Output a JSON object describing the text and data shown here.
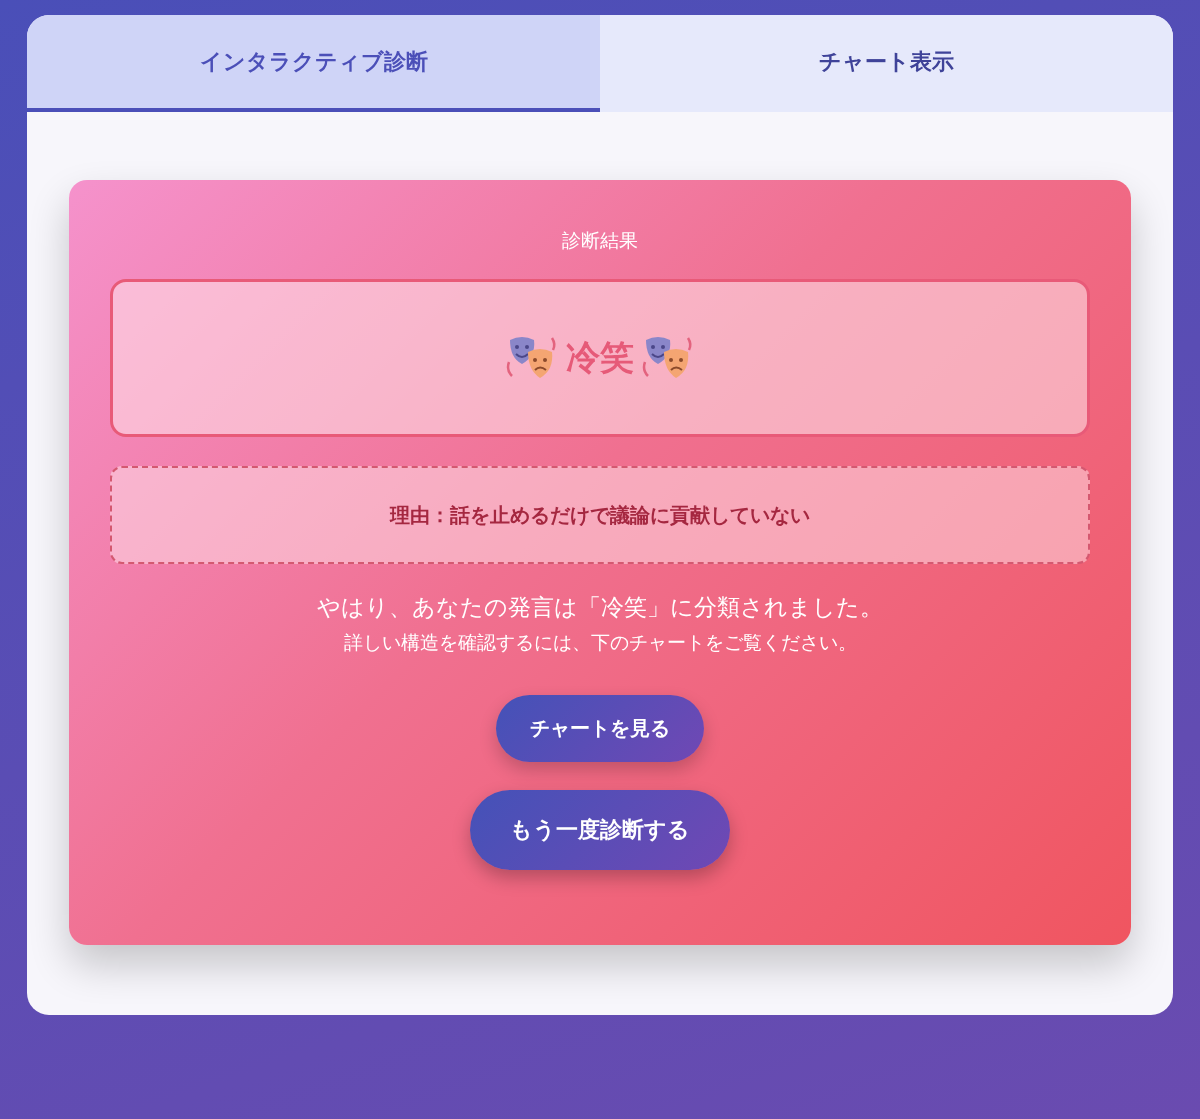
{
  "tabs": [
    {
      "label": "インタラクティブ診断",
      "selected": true
    },
    {
      "label": "チャート表示",
      "selected": false
    }
  ],
  "result": {
    "heading": "診断結果",
    "verdict": "冷笑",
    "reason": "理由：話を止めるだけで議論に貢献していない",
    "message": "やはり、あなたの発言は「冷笑」に分類されました。",
    "hint": "詳しい構造を確認するには、下のチャートをご覧ください。"
  },
  "buttons": [
    {
      "label": "チャートを見る",
      "kind": "small"
    },
    {
      "label": "もう一度診断する",
      "kind": "large"
    }
  ]
}
